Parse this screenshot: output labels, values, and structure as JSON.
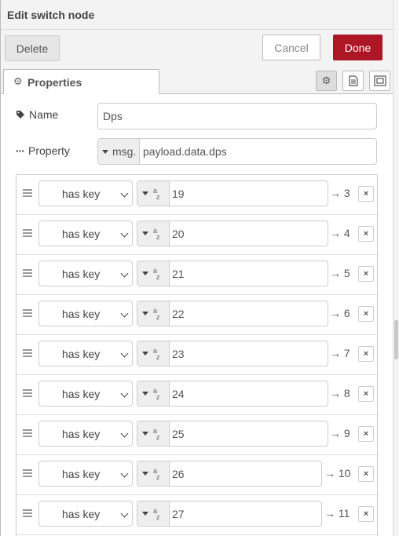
{
  "header": {
    "title": "Edit switch node"
  },
  "toolbar": {
    "delete_label": "Delete",
    "cancel_label": "Cancel",
    "done_label": "Done"
  },
  "tabs": {
    "properties_label": "Properties"
  },
  "form": {
    "name_label": "Name",
    "name_value": "Dps",
    "property_label": "Property",
    "property_type": "msg.",
    "property_value": "payload.data.dps"
  },
  "rules": [
    {
      "operator": "has key",
      "value": "19",
      "output": "→ 3",
      "remove": "×"
    },
    {
      "operator": "has key",
      "value": "20",
      "output": "→ 4",
      "remove": "×"
    },
    {
      "operator": "has key",
      "value": "21",
      "output": "→ 5",
      "remove": "×"
    },
    {
      "operator": "has key",
      "value": "22",
      "output": "→ 6",
      "remove": "×"
    },
    {
      "operator": "has key",
      "value": "23",
      "output": "→ 7",
      "remove": "×"
    },
    {
      "operator": "has key",
      "value": "24",
      "output": "→ 8",
      "remove": "×"
    },
    {
      "operator": "has key",
      "value": "25",
      "output": "→ 9",
      "remove": "×"
    },
    {
      "operator": "has key",
      "value": "26",
      "output": "→ 10",
      "remove": "×"
    },
    {
      "operator": "has key",
      "value": "27",
      "output": "→ 11",
      "remove": "×"
    }
  ],
  "colors": {
    "accent": "#ad1625",
    "border": "#cccccc",
    "panel_bg": "#f3f3f3"
  }
}
